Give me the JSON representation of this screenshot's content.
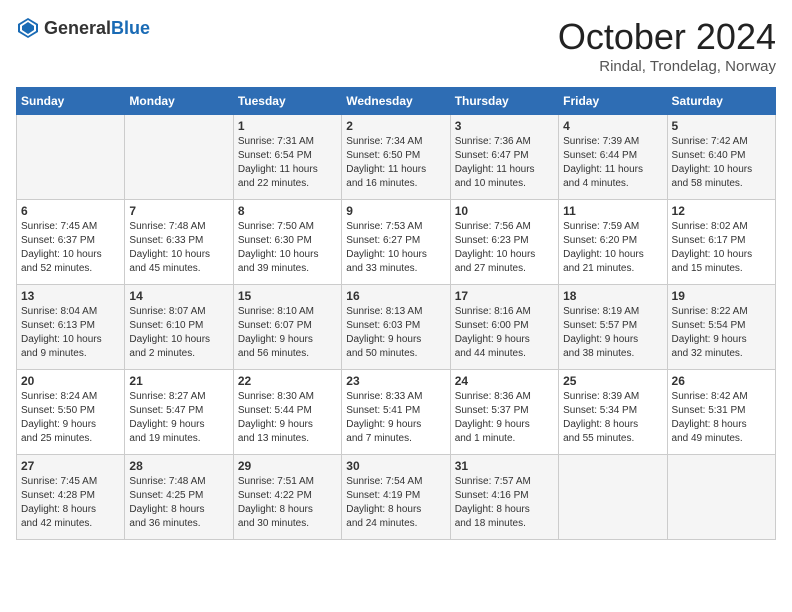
{
  "logo": {
    "general": "General",
    "blue": "Blue"
  },
  "header": {
    "month": "October 2024",
    "location": "Rindal, Trondelag, Norway"
  },
  "weekdays": [
    "Sunday",
    "Monday",
    "Tuesday",
    "Wednesday",
    "Thursday",
    "Friday",
    "Saturday"
  ],
  "weeks": [
    [
      {
        "day": "",
        "info": ""
      },
      {
        "day": "",
        "info": ""
      },
      {
        "day": "1",
        "info": "Sunrise: 7:31 AM\nSunset: 6:54 PM\nDaylight: 11 hours\nand 22 minutes."
      },
      {
        "day": "2",
        "info": "Sunrise: 7:34 AM\nSunset: 6:50 PM\nDaylight: 11 hours\nand 16 minutes."
      },
      {
        "day": "3",
        "info": "Sunrise: 7:36 AM\nSunset: 6:47 PM\nDaylight: 11 hours\nand 10 minutes."
      },
      {
        "day": "4",
        "info": "Sunrise: 7:39 AM\nSunset: 6:44 PM\nDaylight: 11 hours\nand 4 minutes."
      },
      {
        "day": "5",
        "info": "Sunrise: 7:42 AM\nSunset: 6:40 PM\nDaylight: 10 hours\nand 58 minutes."
      }
    ],
    [
      {
        "day": "6",
        "info": "Sunrise: 7:45 AM\nSunset: 6:37 PM\nDaylight: 10 hours\nand 52 minutes."
      },
      {
        "day": "7",
        "info": "Sunrise: 7:48 AM\nSunset: 6:33 PM\nDaylight: 10 hours\nand 45 minutes."
      },
      {
        "day": "8",
        "info": "Sunrise: 7:50 AM\nSunset: 6:30 PM\nDaylight: 10 hours\nand 39 minutes."
      },
      {
        "day": "9",
        "info": "Sunrise: 7:53 AM\nSunset: 6:27 PM\nDaylight: 10 hours\nand 33 minutes."
      },
      {
        "day": "10",
        "info": "Sunrise: 7:56 AM\nSunset: 6:23 PM\nDaylight: 10 hours\nand 27 minutes."
      },
      {
        "day": "11",
        "info": "Sunrise: 7:59 AM\nSunset: 6:20 PM\nDaylight: 10 hours\nand 21 minutes."
      },
      {
        "day": "12",
        "info": "Sunrise: 8:02 AM\nSunset: 6:17 PM\nDaylight: 10 hours\nand 15 minutes."
      }
    ],
    [
      {
        "day": "13",
        "info": "Sunrise: 8:04 AM\nSunset: 6:13 PM\nDaylight: 10 hours\nand 9 minutes."
      },
      {
        "day": "14",
        "info": "Sunrise: 8:07 AM\nSunset: 6:10 PM\nDaylight: 10 hours\nand 2 minutes."
      },
      {
        "day": "15",
        "info": "Sunrise: 8:10 AM\nSunset: 6:07 PM\nDaylight: 9 hours\nand 56 minutes."
      },
      {
        "day": "16",
        "info": "Sunrise: 8:13 AM\nSunset: 6:03 PM\nDaylight: 9 hours\nand 50 minutes."
      },
      {
        "day": "17",
        "info": "Sunrise: 8:16 AM\nSunset: 6:00 PM\nDaylight: 9 hours\nand 44 minutes."
      },
      {
        "day": "18",
        "info": "Sunrise: 8:19 AM\nSunset: 5:57 PM\nDaylight: 9 hours\nand 38 minutes."
      },
      {
        "day": "19",
        "info": "Sunrise: 8:22 AM\nSunset: 5:54 PM\nDaylight: 9 hours\nand 32 minutes."
      }
    ],
    [
      {
        "day": "20",
        "info": "Sunrise: 8:24 AM\nSunset: 5:50 PM\nDaylight: 9 hours\nand 25 minutes."
      },
      {
        "day": "21",
        "info": "Sunrise: 8:27 AM\nSunset: 5:47 PM\nDaylight: 9 hours\nand 19 minutes."
      },
      {
        "day": "22",
        "info": "Sunrise: 8:30 AM\nSunset: 5:44 PM\nDaylight: 9 hours\nand 13 minutes."
      },
      {
        "day": "23",
        "info": "Sunrise: 8:33 AM\nSunset: 5:41 PM\nDaylight: 9 hours\nand 7 minutes."
      },
      {
        "day": "24",
        "info": "Sunrise: 8:36 AM\nSunset: 5:37 PM\nDaylight: 9 hours\nand 1 minute."
      },
      {
        "day": "25",
        "info": "Sunrise: 8:39 AM\nSunset: 5:34 PM\nDaylight: 8 hours\nand 55 minutes."
      },
      {
        "day": "26",
        "info": "Sunrise: 8:42 AM\nSunset: 5:31 PM\nDaylight: 8 hours\nand 49 minutes."
      }
    ],
    [
      {
        "day": "27",
        "info": "Sunrise: 7:45 AM\nSunset: 4:28 PM\nDaylight: 8 hours\nand 42 minutes."
      },
      {
        "day": "28",
        "info": "Sunrise: 7:48 AM\nSunset: 4:25 PM\nDaylight: 8 hours\nand 36 minutes."
      },
      {
        "day": "29",
        "info": "Sunrise: 7:51 AM\nSunset: 4:22 PM\nDaylight: 8 hours\nand 30 minutes."
      },
      {
        "day": "30",
        "info": "Sunrise: 7:54 AM\nSunset: 4:19 PM\nDaylight: 8 hours\nand 24 minutes."
      },
      {
        "day": "31",
        "info": "Sunrise: 7:57 AM\nSunset: 4:16 PM\nDaylight: 8 hours\nand 18 minutes."
      },
      {
        "day": "",
        "info": ""
      },
      {
        "day": "",
        "info": ""
      }
    ]
  ]
}
